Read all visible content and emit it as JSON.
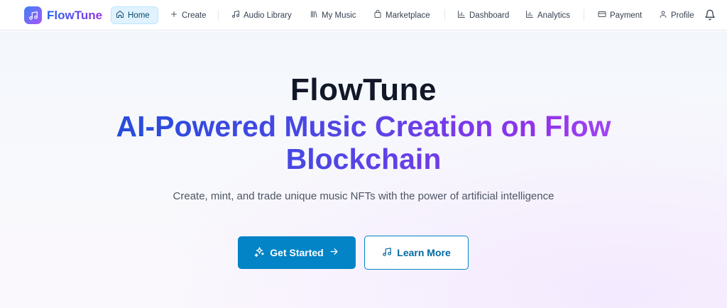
{
  "app": {
    "name": "FlowTune",
    "logo_icon": "music-note-icon"
  },
  "nav": {
    "items": [
      {
        "label": "Home",
        "icon": "home-icon",
        "active": true
      },
      {
        "label": "Create",
        "icon": "plus-icon"
      },
      {
        "label": "Audio Library",
        "icon": "music-note-icon"
      },
      {
        "label": "My Music",
        "icon": "library-icon"
      },
      {
        "label": "Marketplace",
        "icon": "shopping-bag-icon"
      },
      {
        "label": "Dashboard",
        "icon": "bar-chart-icon"
      },
      {
        "label": "Analytics",
        "icon": "bar-chart-icon"
      },
      {
        "label": "Payment",
        "icon": "credit-card-icon"
      },
      {
        "label": "Profile",
        "icon": "user-icon"
      }
    ],
    "notifications_icon": "bell-icon"
  },
  "hero": {
    "title": "FlowTune",
    "subtitle": "AI-Powered Music Creation on Flow Blockchain",
    "description": "Create, mint, and trade unique music NFTs with the power of artificial intelligence",
    "primary_button": {
      "label": "Get Started",
      "icon": "sparkles-icon",
      "trailing_icon": "arrow-right-icon"
    },
    "secondary_button": {
      "label": "Learn More",
      "icon": "music-note-icon"
    }
  },
  "colors": {
    "accent": "#0284c7",
    "gradient_start": "#1d4ed8",
    "gradient_end": "#a855f7",
    "active_nav_bg": "#e0f2fe"
  }
}
